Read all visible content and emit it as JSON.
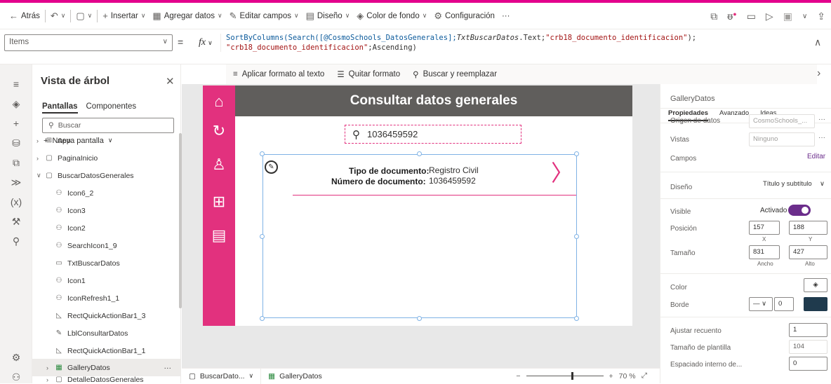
{
  "colors": {
    "accent": "#e2317e",
    "purple": "#6b2d8b",
    "header": "#605e5c"
  },
  "toolbar": {
    "back": "Atrás",
    "insert": "Insertar",
    "add_data": "Agregar datos",
    "edit_fields": "Editar campos",
    "design": "Diseño",
    "bg_color": "Color de fondo",
    "settings": "Configuración",
    "more": "···"
  },
  "formula_bar": {
    "property": "Items",
    "equals": "=",
    "fx": "fx",
    "formula_line1_a": "SortByColumns(Search([@CosmoSchools_DatosGenerales];",
    "formula_line1_b": "TxtBuscarDatos",
    "formula_line1_c": ".Text;",
    "formula_line1_d": "\"crb18_documento_identificacion\"",
    "formula_line1_e": ");",
    "formula_line2_a": "\"crb18_documento_identificacion\"",
    "formula_line2_b": ";Ascending)"
  },
  "format_bar": {
    "format_text": "Aplicar formato al texto",
    "remove_format": "Quitar formato",
    "find_replace": "Buscar y reemplazar"
  },
  "tree": {
    "title": "Vista de árbol",
    "tab_screens": "Pantallas",
    "tab_components": "Componentes",
    "search_placeholder": "Buscar",
    "new_screen": "Nueva pantalla",
    "nodes": [
      {
        "label": "App"
      },
      {
        "label": "PaginaInicio"
      },
      {
        "label": "BuscarDatosGenerales"
      },
      {
        "label": "Icon6_2"
      },
      {
        "label": "Icon3"
      },
      {
        "label": "Icon2"
      },
      {
        "label": "SearchIcon1_9"
      },
      {
        "label": "TxtBuscarDatos"
      },
      {
        "label": "Icon1"
      },
      {
        "label": "IconRefresh1_1"
      },
      {
        "label": "RectQuickActionBar1_3"
      },
      {
        "label": "LblConsultarDatos"
      },
      {
        "label": "RectQuickActionBar1_1"
      },
      {
        "label": "GalleryDatos"
      },
      {
        "label": "DetalleDatosGenerales"
      }
    ]
  },
  "canvas": {
    "header_title": "Consultar datos generales",
    "search_value": "1036459592",
    "doc_type_label": "Tipo de documento:",
    "doc_type_value": "Registro Civil",
    "doc_number_label": "Número de documento:",
    "doc_number_value": "1036459592"
  },
  "bottom": {
    "screen_crumb": "BuscarDato...",
    "control_crumb": "GalleryDatos",
    "zoom": "70 %"
  },
  "props": {
    "control_name": "GalleryDatos",
    "tab_properties": "Propiedades",
    "tab_advanced": "Avanzado",
    "tab_ideas": "Ideas",
    "data_source_label": "Origen de datos",
    "data_source_value": "CosmoSchools_...",
    "views_label": "Vistas",
    "views_value": "Ninguno",
    "fields_label": "Campos",
    "fields_edit": "Editar",
    "layout_label": "Diseño",
    "layout_value": "Título y subtítulo",
    "visible_label": "Visible",
    "visible_value": "Activado",
    "position_label": "Posición",
    "pos_x": "157",
    "pos_y": "188",
    "x_label": "X",
    "y_label": "Y",
    "size_label": "Tamaño",
    "width": "831",
    "height": "427",
    "width_label": "Ancho",
    "height_label": "Alto",
    "color_label": "Color",
    "border_label": "Borde",
    "border_width": "0",
    "autofit_label": "Ajustar recuento",
    "autofit_value": "1",
    "template_size_label": "Tamaño de plantilla",
    "template_size_value": "104",
    "padding_label": "Espaciado interno de...",
    "padding_value": "0"
  }
}
